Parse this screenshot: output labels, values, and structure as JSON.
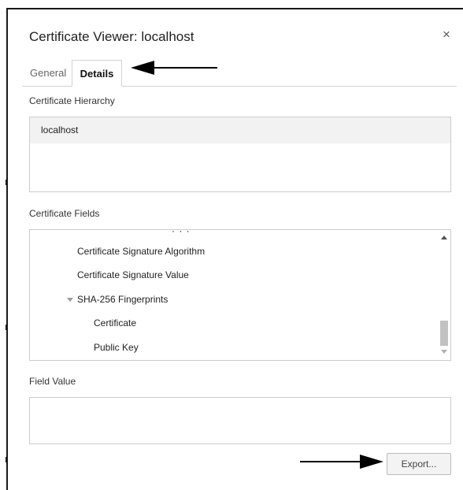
{
  "dialog": {
    "title": "Certificate Viewer: localhost",
    "close_icon": "close-icon",
    "close_glyph": "×"
  },
  "tabs": [
    {
      "label": "General",
      "active": false
    },
    {
      "label": "Details",
      "active": true
    }
  ],
  "hierarchy": {
    "label": "Certificate Hierarchy",
    "items": [
      "localhost"
    ]
  },
  "fields": {
    "label": "Certificate Fields",
    "partial_top_text": "·  ·  ·",
    "items": [
      {
        "label": "Certificate Signature Algorithm",
        "expandable": false
      },
      {
        "label": "Certificate Signature Value",
        "expandable": false
      },
      {
        "label": "SHA-256 Fingerprints",
        "expandable": true,
        "expanded": true
      },
      {
        "label": "Certificate",
        "expandable": false
      },
      {
        "label": "Public Key",
        "expandable": false
      }
    ],
    "scrollbar": {
      "up_icon": "scroll-up-icon",
      "down_icon": "scroll-down-icon"
    }
  },
  "field_value": {
    "label": "Field Value",
    "value": ""
  },
  "actions": {
    "export_label": "Export..."
  },
  "annotations": {
    "arrow_details_icon": "arrow-left-icon",
    "arrow_export_icon": "arrow-right-icon",
    "arrow_color": "#000000"
  },
  "colors": {
    "hierarchy_selected_bg": "#f2f2f2",
    "border": "#cccccc",
    "button_bg": "#f3f3f3"
  }
}
